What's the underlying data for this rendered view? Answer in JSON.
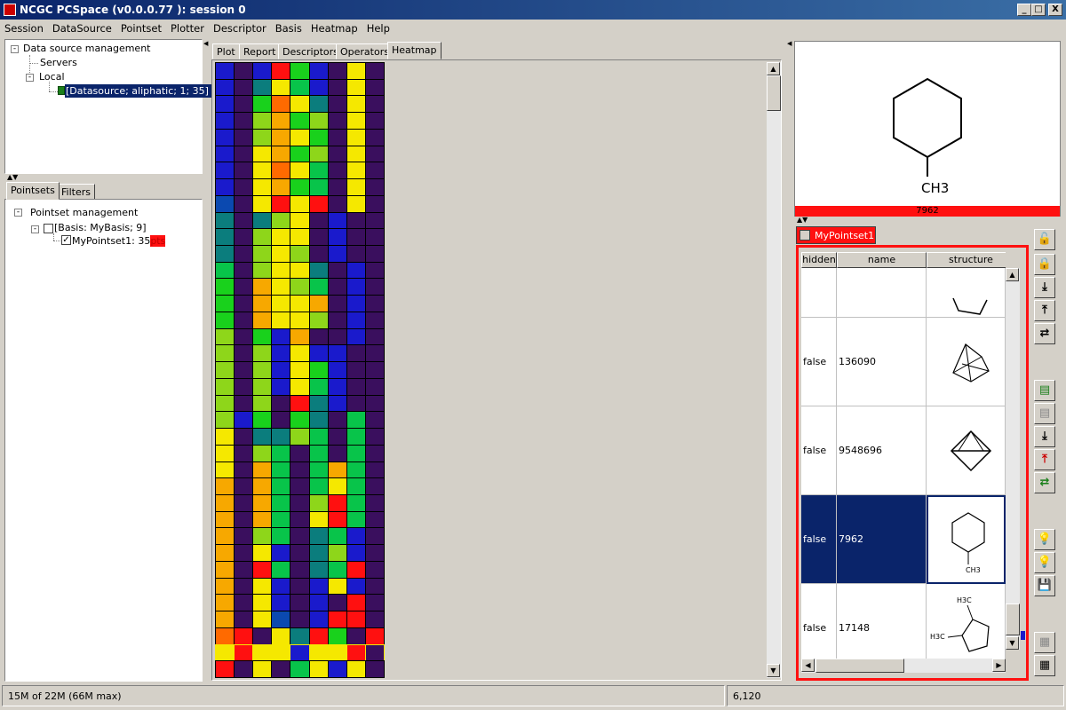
{
  "window": {
    "title": "NCGC PCSpace (v0.0.0.77 ): session 0",
    "min": "_",
    "max": "□",
    "close": "X"
  },
  "menu": [
    "Session",
    "DataSource",
    "Pointset",
    "Plotter",
    "Descriptor",
    "Basis",
    "Heatmap",
    "Help"
  ],
  "datasource_tree": {
    "root": "Data source management",
    "servers": "Servers",
    "local": "Local",
    "item": "[Datasource; aliphatic; 1; 35] !"
  },
  "left_tabs": [
    "Pointsets",
    "Filters"
  ],
  "pointset_tree": {
    "root": "Pointset management",
    "basis": "[Basis: MyBasis; 9]",
    "pointset": "MyPointset1: 35",
    "pointset_suffix": "pts"
  },
  "center_tabs": [
    "Plot",
    "Report",
    "Descriptors",
    "Operators",
    "Heatmap"
  ],
  "heatmap": {
    "colors": {
      "P": "#3a0f5e",
      "B": "#1a1acc",
      "b": "#0b49b0",
      "T": "#0b7d7d",
      "G": "#08c44a",
      "g": "#19d11c",
      "L": "#8ed61a",
      "Y": "#f5e800",
      "O": "#f7a800",
      "o": "#ff6a00",
      "R": "#ff1010"
    },
    "rows": [
      "BPBRgBPY",
      "BPTYGBPY",
      "BPgoYTPY",
      "BPLOgLPY",
      "BPLOYgPY",
      "BPYOgLPY",
      "BPYoYGPY",
      "BPYOgGPY",
      "bPYRYRPY",
      "TPTLYPBP",
      "TPLYYPBP",
      "TPLYLPBP",
      "GPLYYTPB",
      "gPOYLGPB",
      "gPOYYOPB",
      "gPOYYLPB",
      "LPgBOPPB",
      "LPLBYBBP",
      "LPLBYgBP",
      "LPLBYGBP",
      "LPLPRTBP",
      "LBgPgTPG",
      "YPTTLGPG",
      "YPLGPGPG",
      "YPOGPGOG",
      "OPOGPGYG",
      "OPOGPLRG",
      "OPOGPYRG",
      "OPLGPTGB",
      "OPYBPTLB",
      "OPRGPTGR",
      "OPYBPBYB",
      "OPYBPBPR",
      "OPYbPBRR",
      "oRPYTRgPR",
      "YRYYBYYR",
      "RPYPGYBY"
    ]
  },
  "structure_label": "CH3",
  "structure_id": "7962",
  "pointset_tab": "MyPointset1",
  "table": {
    "headers": [
      "hidden",
      "name",
      "structure"
    ],
    "rows": [
      {
        "hidden": "",
        "name": ""
      },
      {
        "hidden": "false",
        "name": "136090"
      },
      {
        "hidden": "false",
        "name": "9548696"
      },
      {
        "hidden": "false",
        "name": "7962",
        "selected": true
      },
      {
        "hidden": "false",
        "name": "17148"
      }
    ]
  },
  "small_labels": {
    "ch3": "CH3",
    "h3c1": "H3C",
    "h3c2": "H3C"
  },
  "status": {
    "memory": "15M of 22M (66M max)",
    "coords": "6,120"
  }
}
